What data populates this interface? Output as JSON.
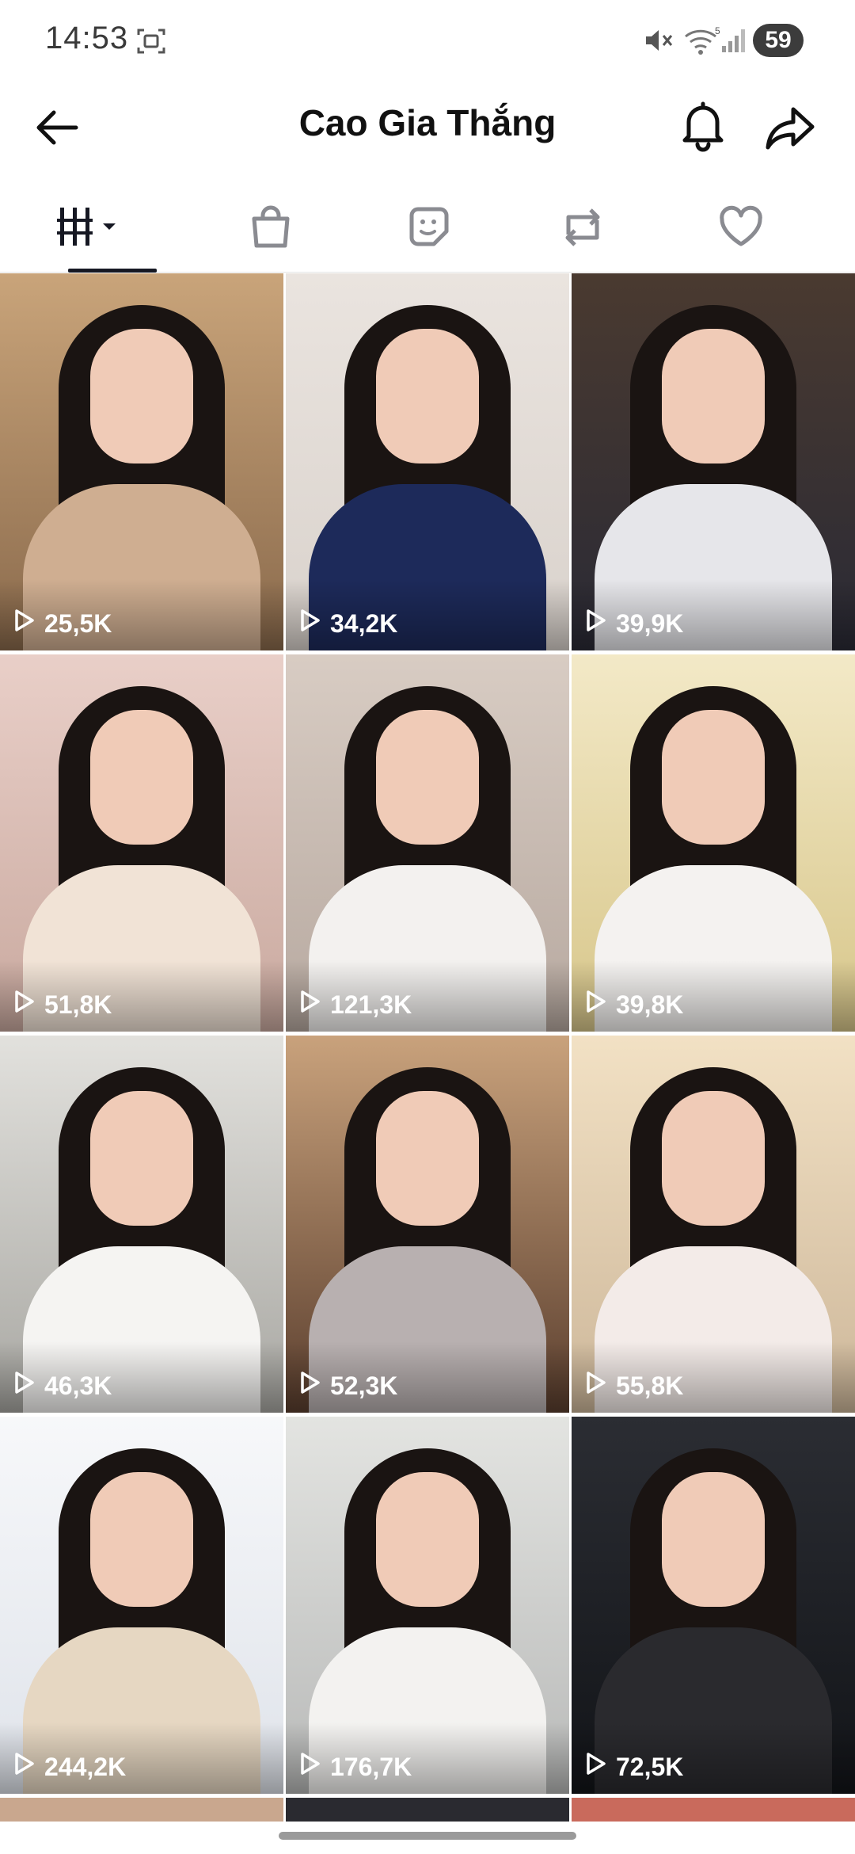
{
  "status_bar": {
    "time": "14:53",
    "battery": "59",
    "icons": [
      "screenshot-icon",
      "mute-icon",
      "wifi-icon",
      "signal-icon"
    ]
  },
  "header": {
    "title": "Cao Gia Thắng",
    "icons": [
      "back-arrow-icon",
      "bell-icon",
      "share-icon"
    ]
  },
  "tabs": [
    {
      "name": "videos",
      "icon": "grid-icon",
      "active": true
    },
    {
      "name": "shop",
      "icon": "shopping-bag-icon",
      "active": false
    },
    {
      "name": "stickers",
      "icon": "sticker-icon",
      "active": false
    },
    {
      "name": "reposts",
      "icon": "repost-icon",
      "active": false
    },
    {
      "name": "liked",
      "icon": "heart-icon",
      "active": false
    }
  ],
  "videos": [
    {
      "views": "25,5K",
      "bg": "#8a6a4c",
      "top": "#c9a47a",
      "outfit": "#cfae91"
    },
    {
      "views": "34,2K",
      "bg": "#d9d2cc",
      "top": "#eae4df",
      "outfit": "#1d2a5a"
    },
    {
      "views": "39,9K",
      "bg": "#2a2a35",
      "top": "#4a3a30",
      "outfit": "#e6e6ea"
    },
    {
      "views": "51,8K",
      "bg": "#c9a99f",
      "top": "#e9cfc8",
      "outfit": "#f1e3d6"
    },
    {
      "views": "121,3K",
      "bg": "#b7a9a0",
      "top": "#d8ccc3",
      "outfit": "#f3f1ef"
    },
    {
      "views": "39,8K",
      "bg": "#d7c68a",
      "top": "#f3e9c7",
      "outfit": "#f4f2f0"
    },
    {
      "views": "46,3K",
      "bg": "#a8a7a2",
      "top": "#e2e1dd",
      "outfit": "#f5f4f2"
    },
    {
      "views": "52,3K",
      "bg": "#5a3e2e",
      "top": "#c9a27c",
      "outfit": "#b8b0b0"
    },
    {
      "views": "55,8K",
      "bg": "#cdb79a",
      "top": "#f2e1c4",
      "outfit": "#f3ebe8"
    },
    {
      "views": "244,2K",
      "bg": "#dfe3ea",
      "top": "#f7f8fa",
      "outfit": "#e6d7c2"
    },
    {
      "views": "176,7K",
      "bg": "#b8b9b8",
      "top": "#e3e4e1",
      "outfit": "#f3f2f0"
    },
    {
      "views": "72,5K",
      "bg": "#121418",
      "top": "#2b2d33",
      "outfit": "#2a2a2e"
    }
  ]
}
